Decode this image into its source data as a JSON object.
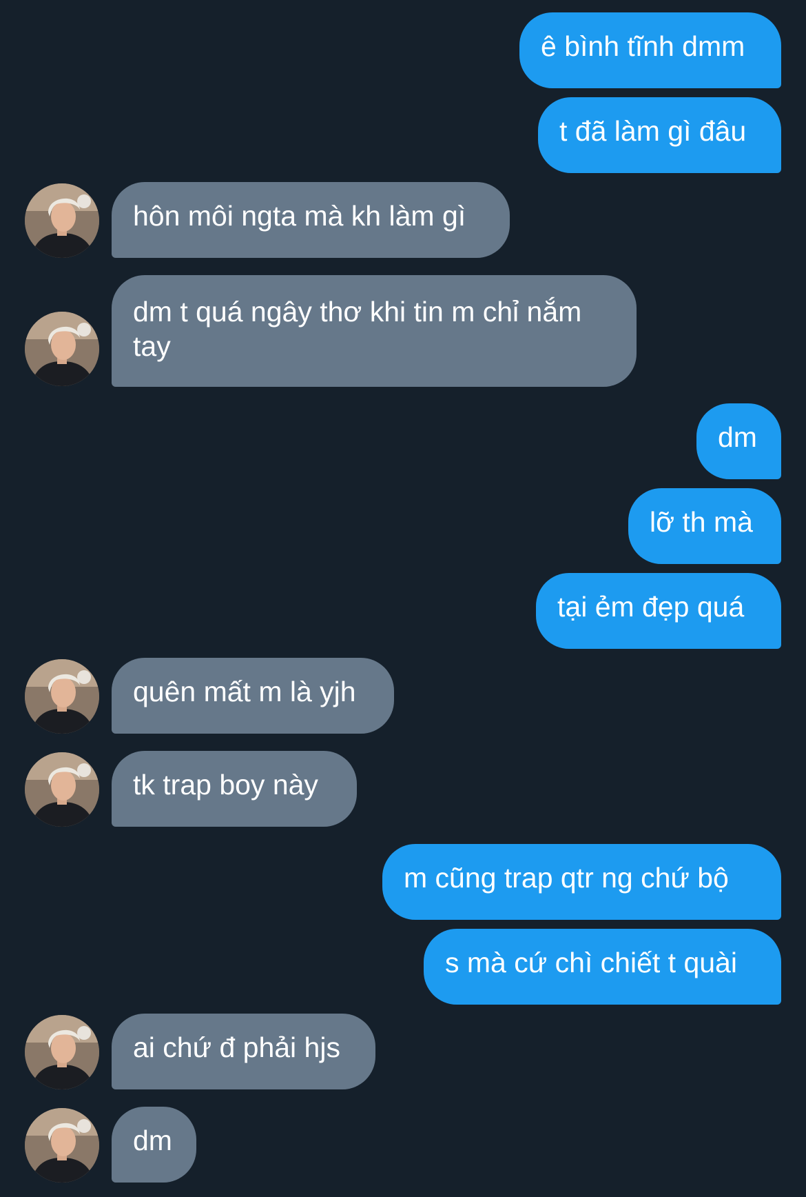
{
  "conversation": {
    "colors": {
      "background": "#15202b",
      "sent_bubble": "#1d9bf0",
      "received_bubble": "#66788a",
      "text": "#ffffff"
    },
    "messages": [
      {
        "from": "me",
        "text": "ê bình tĩnh dmm"
      },
      {
        "from": "me",
        "text": "t đã làm gì đâu"
      },
      {
        "from": "other",
        "text": "hôn môi ngta mà kh làm gì"
      },
      {
        "from": "other",
        "text": "dm t quá ngây thơ khi tin m chỉ nắm tay"
      },
      {
        "from": "me",
        "text": "dm"
      },
      {
        "from": "me",
        "text": "lỡ th mà"
      },
      {
        "from": "me",
        "text": "tại ẻm đẹp quá"
      },
      {
        "from": "other",
        "text": "quên mất m là yjh"
      },
      {
        "from": "other",
        "text": "tk trap boy này"
      },
      {
        "from": "me",
        "text": "m cũng trap qtr ng chứ bộ"
      },
      {
        "from": "me",
        "text": "s mà cứ chì chiết t quài"
      },
      {
        "from": "other",
        "text": "ai chứ đ phải hjs"
      },
      {
        "from": "other",
        "text": "dm"
      }
    ]
  }
}
